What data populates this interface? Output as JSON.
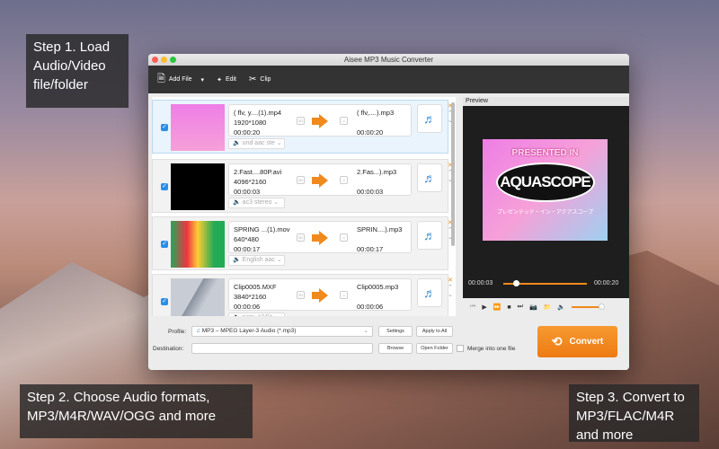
{
  "window": {
    "title": "Aisee MP3 Music Converter"
  },
  "toolbar": {
    "add_file": "Add File",
    "edit": "Edit",
    "clip": "Clip"
  },
  "files": [
    {
      "name": "( flv, y....(1).mp4",
      "resolution": "1920*1080",
      "duration": "00:00:20",
      "output": "( flv,....).mp3",
      "out_duration": "00:00:20",
      "audio": "und aac ste",
      "selected": true
    },
    {
      "name": "2.Fast....80P.avi",
      "resolution": "4096*2160",
      "duration": "00:00:03",
      "output": "2.Fas...).mp3",
      "out_duration": "00:00:03",
      "audio": "ac3 stereo",
      "selected": false
    },
    {
      "name": "SPRING ...(1).mov",
      "resolution": "640*480",
      "duration": "00:00:17",
      "output": "SPRIN....).mp3",
      "out_duration": "00:00:17",
      "audio": "English aac",
      "selected": false
    },
    {
      "name": "Clip0005.MXF",
      "resolution": "3840*2160",
      "duration": "00:00:06",
      "output": "Clip0005.mp3",
      "out_duration": "00:00:06",
      "audio": "pcm_s24le",
      "selected": false
    }
  ],
  "badges": {
    "d3": "2D",
    "music": "♫"
  },
  "preview": {
    "label": "Preview",
    "current_time": "00:00:03",
    "total_time": "00:00:20",
    "progress": 0.15,
    "volume": 0.9,
    "video_top": "PRESENTED IN",
    "video_logo": "AQUASCOPE",
    "video_bottom": "プレゼンテッド・イン・アクアスコープ"
  },
  "bottom": {
    "profile_label": "Profile:",
    "profile_value": "MP3 – MPEG Layer-3 Audio (*.mp3)",
    "settings": "Settings",
    "apply_all": "Apply to All",
    "destination_label": "Destination:",
    "destination_value": "",
    "browse": "Browse",
    "open_folder": "Open Folder",
    "merge": "Merge into one file",
    "convert": "Convert"
  },
  "callouts": {
    "step1": "Step 1.  Load Audio/Video file/folder",
    "step2": "Step 2. Choose Audio formats, MP3/M4R/WAV/OGG and more",
    "step3": "Step 3. Convert to MP3/FLAC/M4R and more"
  },
  "colors": {
    "accent": "#f08a1c",
    "toolbar": "#333333",
    "selection": "#2a8ee6"
  }
}
